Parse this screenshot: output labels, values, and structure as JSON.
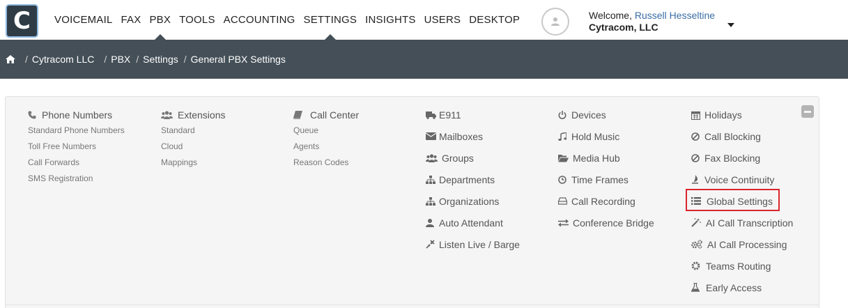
{
  "logo": {
    "letter": "C"
  },
  "nav": {
    "items": [
      {
        "label": "VOICEMAIL"
      },
      {
        "label": "FAX"
      },
      {
        "label": "PBX"
      },
      {
        "label": "TOOLS"
      },
      {
        "label": "ACCOUNTING"
      },
      {
        "label": "SETTINGS"
      },
      {
        "label": "INSIGHTS"
      },
      {
        "label": "USERS"
      },
      {
        "label": "DESKTOP"
      }
    ]
  },
  "user": {
    "welcome_prefix": "Welcome,",
    "name": "Russell Hesseltine",
    "company": "Cytracom, LLC"
  },
  "breadcrumb": [
    "Cytracom LLC",
    "PBX",
    "Settings",
    "General PBX Settings"
  ],
  "columns": [
    {
      "title": "Phone Numbers",
      "icon": "phone-icon",
      "items": [
        "Standard Phone Numbers",
        "Toll Free Numbers",
        "Call Forwards",
        "SMS Registration"
      ]
    },
    {
      "title": "Extensions",
      "icon": "users-icon",
      "items": [
        "Standard",
        "Cloud",
        "Mappings"
      ]
    },
    {
      "title": "Call Center",
      "icon": "book-icon",
      "items": [
        "Queue",
        "Agents",
        "Reason Codes"
      ]
    }
  ],
  "links": {
    "col1": [
      {
        "label": "E911",
        "icon": "truck-icon"
      },
      {
        "label": "Mailboxes",
        "icon": "envelope-icon"
      },
      {
        "label": "Groups",
        "icon": "users-icon"
      },
      {
        "label": "Departments",
        "icon": "sitemap-icon"
      },
      {
        "label": "Organizations",
        "icon": "sitemap-icon"
      },
      {
        "label": "Auto Attendant",
        "icon": "user-icon"
      },
      {
        "label": "Listen Live / Barge",
        "icon": "compress-icon"
      }
    ],
    "col2": [
      {
        "label": "Devices",
        "icon": "power-icon"
      },
      {
        "label": "Hold Music",
        "icon": "music-icon"
      },
      {
        "label": "Media Hub",
        "icon": "folder-open-icon"
      },
      {
        "label": "Time Frames",
        "icon": "clock-icon"
      },
      {
        "label": "Call Recording",
        "icon": "hdd-icon"
      },
      {
        "label": "Conference Bridge",
        "icon": "exchange-icon"
      }
    ],
    "col3": [
      {
        "label": "Holidays",
        "icon": "calendar-icon"
      },
      {
        "label": "Call Blocking",
        "icon": "ban-icon"
      },
      {
        "label": "Fax Blocking",
        "icon": "ban-icon"
      },
      {
        "label": "Voice Continuity",
        "icon": "fire-icon"
      },
      {
        "label": "Global Settings",
        "icon": "list-icon"
      },
      {
        "label": "AI Call Transcription",
        "icon": "magic-icon"
      },
      {
        "label": "AI Call Processing",
        "icon": "cogs-icon"
      },
      {
        "label": "Teams Routing",
        "icon": "cog-icon"
      },
      {
        "label": "Early Access",
        "icon": "flask-icon"
      }
    ]
  },
  "colors": {
    "header_dark": "#444f57",
    "logo_bg": "#2f3c46",
    "highlight": "#d9262b",
    "link_user": "#3a6ea5"
  }
}
